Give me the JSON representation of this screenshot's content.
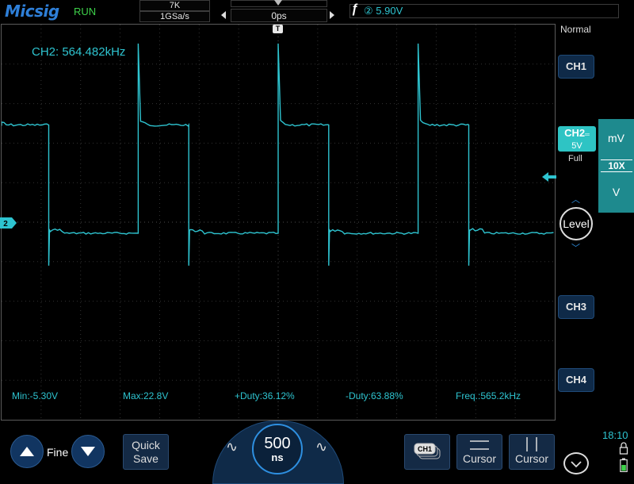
{
  "header": {
    "brand": "Micsig",
    "run_state": "RUN",
    "memory_depth": "7K",
    "sample_rate": "1GSa/s",
    "time_position": "0ps",
    "trigger_source": "②",
    "trigger_level": "5.90V"
  },
  "screen": {
    "frequency_readout": "CH2: 564.482kHz",
    "channel_marker": "2",
    "trigger_marker": "T",
    "measurements": {
      "min": "Min:-5.30V",
      "max": "Max:22.8V",
      "pos_duty": "+Duty:36.12%",
      "neg_duty": "-Duty:63.88%",
      "freq": "Freq.:565.2kHz"
    }
  },
  "right_panel": {
    "acquire_mode": "Normal",
    "ch1_label": "CH1",
    "ch2_label": "CH2",
    "ch2_scale": "5V",
    "ch2_bandwidth": "Full",
    "ch3_label": "CH3",
    "ch4_label": "CH4",
    "probe_unit_mv": "mV",
    "probe_ratio": "10X",
    "probe_unit_v": "V",
    "level_label": "Level"
  },
  "bottom": {
    "fine_label": "Fine",
    "quick_save_line1": "Quick",
    "quick_save_line2": "Save",
    "timebase_value": "500",
    "timebase_unit": "ns",
    "ch1_chip": "CH1",
    "cursor_h_label": "Cursor",
    "cursor_v_label": "Cursor",
    "clock": "18:10"
  },
  "colors": {
    "trace": "#2ec4d0",
    "brand": "#2e7fd8",
    "run": "#3ed14a",
    "button_bg": "#0f2a48"
  },
  "waveform": {
    "frequency_khz": 564.482,
    "duty_cycle_percent": 36.12,
    "min_v": -5.3,
    "max_v": 22.8,
    "volts_per_div": 5,
    "ns_per_div": 500
  }
}
